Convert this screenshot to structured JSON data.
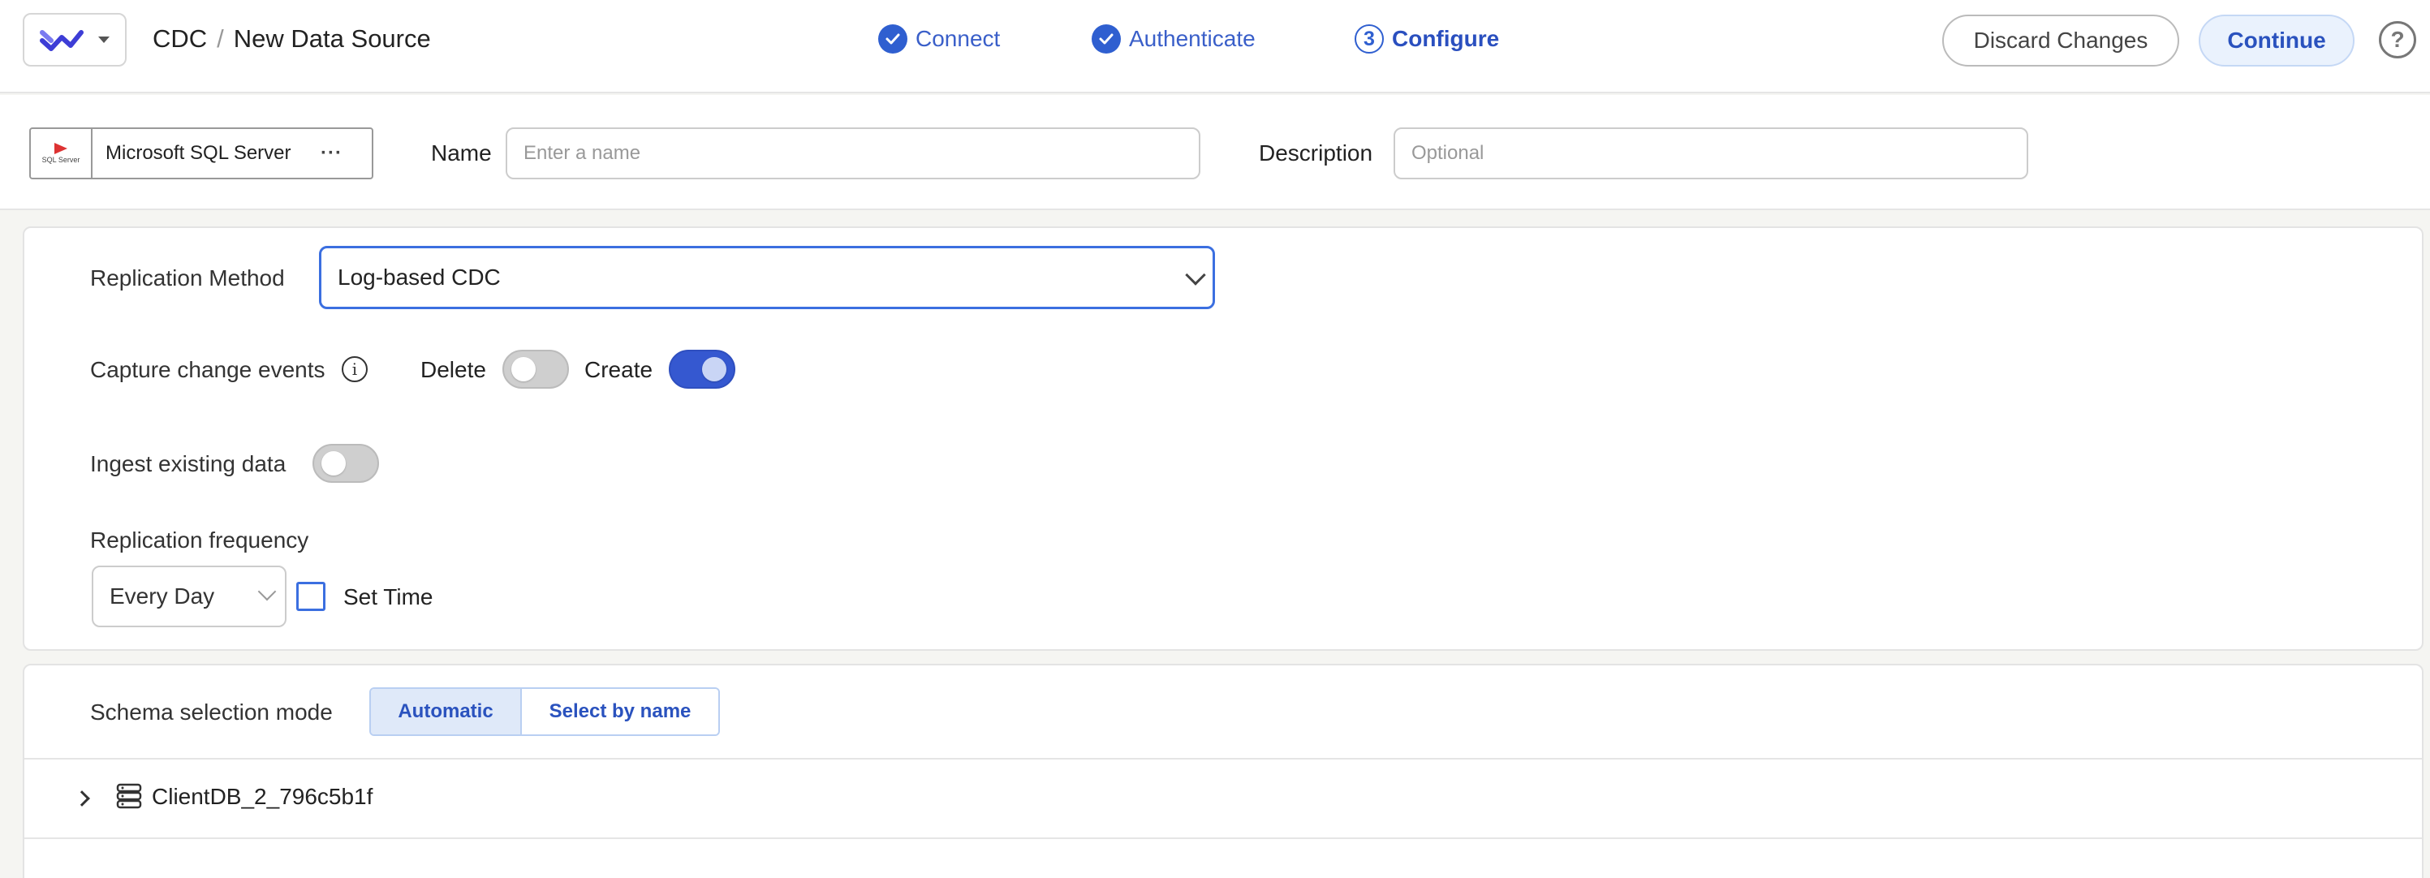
{
  "header": {
    "breadcrumb_root": "CDC",
    "breadcrumb_sep": "/",
    "breadcrumb_current": "New Data Source",
    "steps": [
      {
        "label": "Connect",
        "status": "done"
      },
      {
        "label": "Authenticate",
        "status": "done"
      },
      {
        "label": "Configure",
        "number": "3",
        "status": "active"
      }
    ],
    "discard_label": "Discard Changes",
    "continue_label": "Continue",
    "help_glyph": "?"
  },
  "source": {
    "connector_name": "Microsoft SQL Server",
    "connector_logo_text": "SQL Server",
    "more_glyph": "···",
    "name_label": "Name",
    "name_placeholder": "Enter a name",
    "name_value": "",
    "description_label": "Description",
    "description_placeholder": "Optional",
    "description_value": ""
  },
  "settings": {
    "replication_method_label": "Replication Method",
    "replication_method_value": "Log-based CDC",
    "capture_label": "Capture change events",
    "info_glyph": "i",
    "delete_label": "Delete",
    "delete_on": false,
    "create_label": "Create",
    "create_on": true,
    "ingest_label": "Ingest existing data",
    "ingest_on": false,
    "frequency_label": "Replication frequency",
    "frequency_value": "Every Day",
    "set_time_label": "Set Time",
    "set_time_checked": false
  },
  "schema": {
    "mode_label": "Schema selection mode",
    "modes": [
      "Automatic",
      "Select by name"
    ],
    "active_mode": "Automatic",
    "databases": [
      "ClientDB_2_796c5b1f"
    ]
  },
  "colors": {
    "accent": "#2f5fd0",
    "toggle_on": "#3558d0",
    "brand": "#3d3dd6"
  },
  "icons": {
    "logo": "hightouch-logo-icon",
    "step_done": "check-circle-icon",
    "help": "help-circle-icon",
    "info": "info-icon",
    "tree_expand": "chevron-right-icon",
    "database": "database-icon"
  }
}
